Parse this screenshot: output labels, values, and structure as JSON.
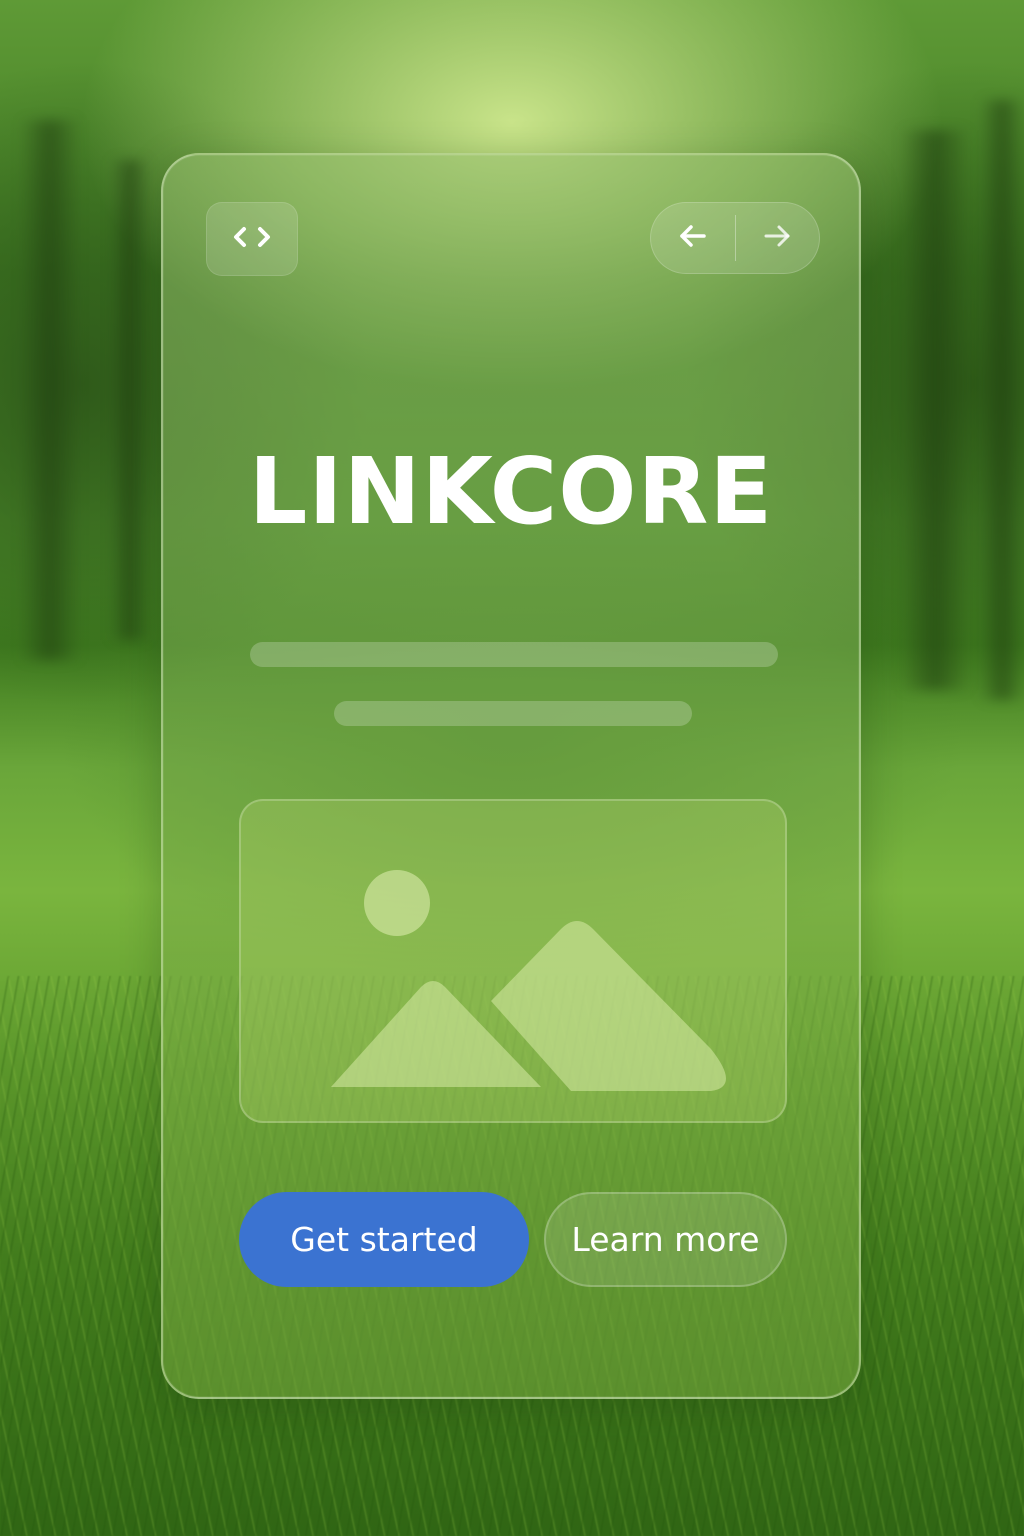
{
  "app": {
    "title": "LINKCORE"
  },
  "toolbar": {
    "code_icon": "code-icon",
    "back_icon": "arrow-left-icon",
    "forward_icon": "arrow-right-icon"
  },
  "hero": {
    "image_icon": "image-icon"
  },
  "actions": {
    "primary_label": "Get started",
    "secondary_label": "Learn more"
  },
  "colors": {
    "primary_button": "#3b73d1",
    "text": "#ffffff"
  }
}
